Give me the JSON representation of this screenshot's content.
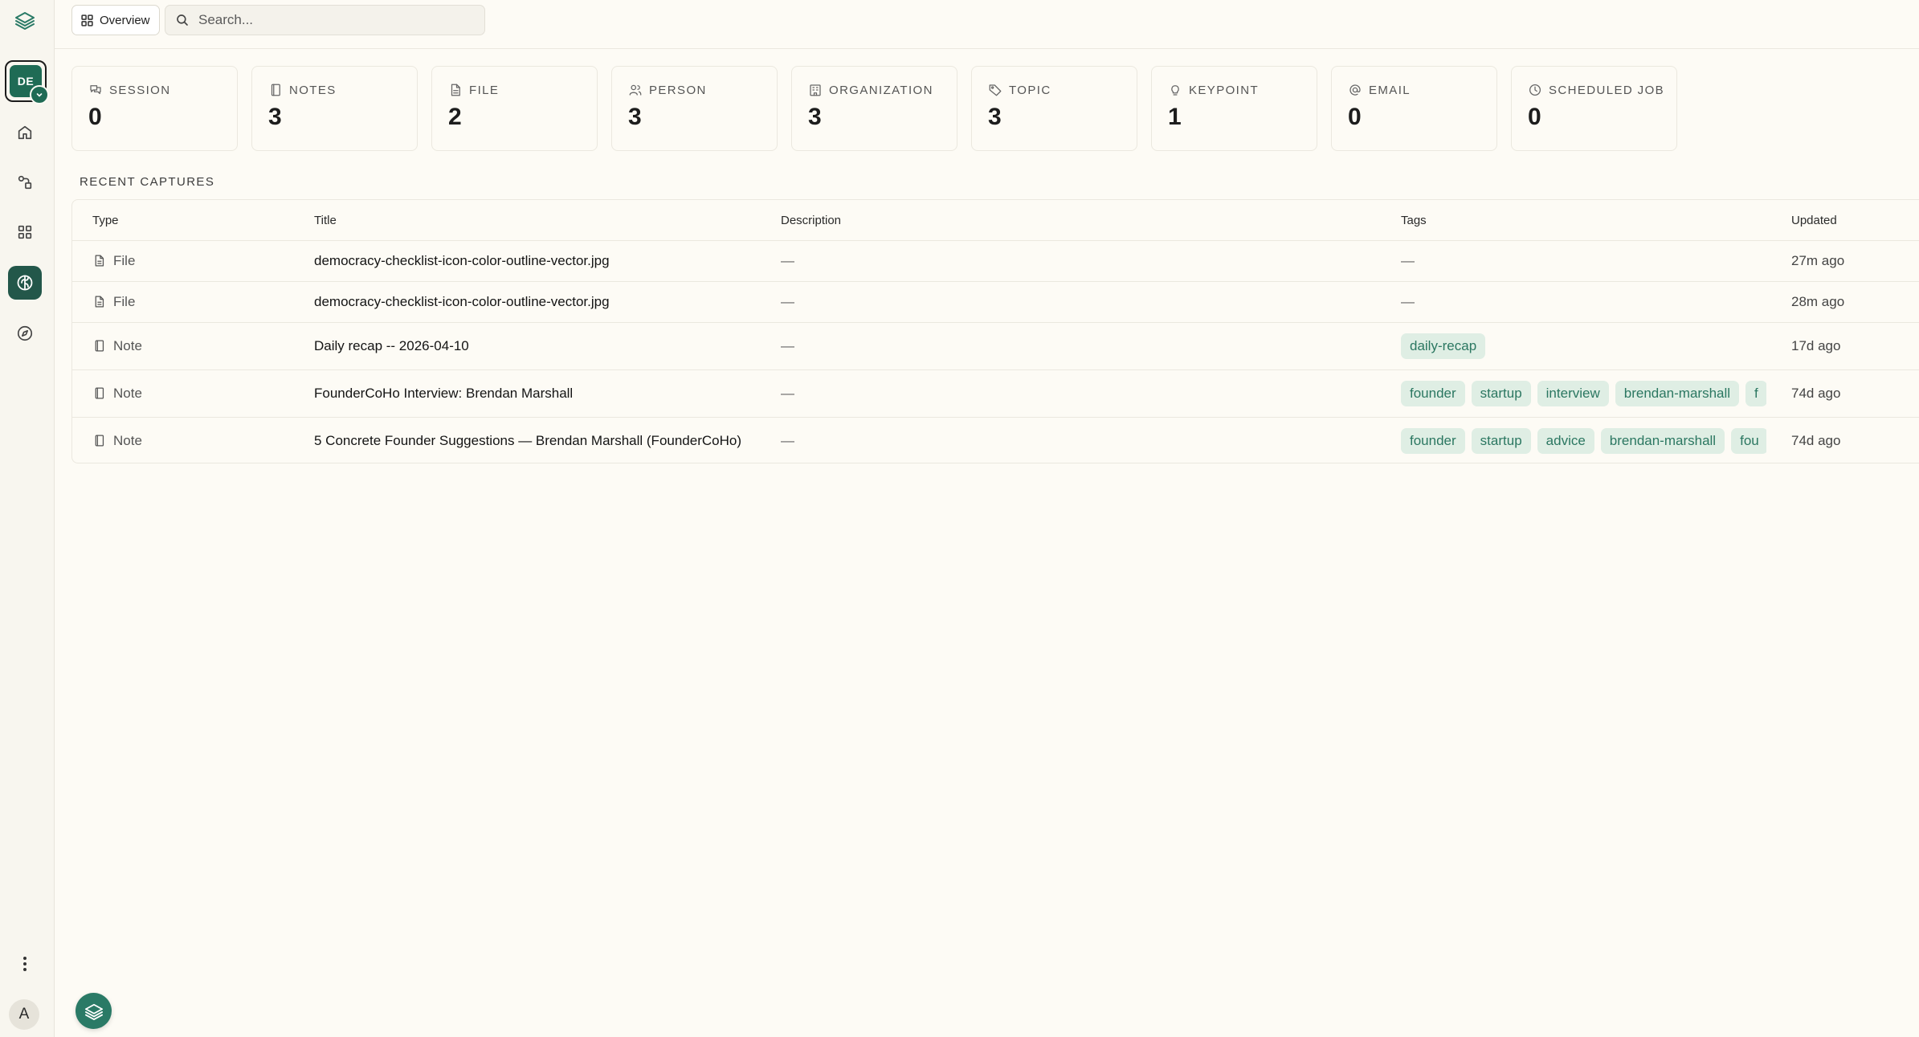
{
  "topbar": {
    "overview_label": "Overview",
    "search_placeholder": "Search..."
  },
  "sidebar": {
    "workspace_initials": "DE",
    "user_initial": "A",
    "nav_items": [
      {
        "name": "home",
        "icon": "home-icon"
      },
      {
        "name": "workflows",
        "icon": "workflow-icon"
      },
      {
        "name": "apps",
        "icon": "grid-icon"
      },
      {
        "name": "knowledge",
        "icon": "brain-icon",
        "active": true
      },
      {
        "name": "explore",
        "icon": "compass-icon"
      }
    ]
  },
  "stats": [
    {
      "label": "SESSION",
      "value": "0",
      "icon": "chat-icon"
    },
    {
      "label": "NOTES",
      "value": "3",
      "icon": "notebook-icon"
    },
    {
      "label": "FILE",
      "value": "2",
      "icon": "file-icon"
    },
    {
      "label": "PERSON",
      "value": "3",
      "icon": "people-icon"
    },
    {
      "label": "ORGANIZATION",
      "value": "3",
      "icon": "building-icon"
    },
    {
      "label": "TOPIC",
      "value": "3",
      "icon": "tag-icon"
    },
    {
      "label": "KEYPOINT",
      "value": "1",
      "icon": "lightbulb-icon"
    },
    {
      "label": "EMAIL",
      "value": "0",
      "icon": "at-icon"
    },
    {
      "label": "SCHEDULED JOB",
      "value": "0",
      "icon": "clock-icon"
    }
  ],
  "recent": {
    "title": "RECENT CAPTURES",
    "columns": {
      "type": "Type",
      "title": "Title",
      "description": "Description",
      "tags": "Tags",
      "updated": "Updated"
    },
    "rows": [
      {
        "type": "File",
        "title": "democracy-checklist-icon-color-outline-vector.jpg",
        "description": "—",
        "tags": [],
        "tags_empty": "—",
        "updated": "27m ago"
      },
      {
        "type": "File",
        "title": "democracy-checklist-icon-color-outline-vector.jpg",
        "description": "—",
        "tags": [],
        "tags_empty": "—",
        "updated": "28m ago"
      },
      {
        "type": "Note",
        "title": "Daily recap -- 2026-04-10",
        "description": "—",
        "tags": [
          "daily-recap"
        ],
        "updated": "17d ago"
      },
      {
        "type": "Note",
        "title": "FounderCoHo Interview: Brendan Marshall",
        "description": "—",
        "tags": [
          "founder",
          "startup",
          "interview",
          "brendan-marshall",
          "f"
        ],
        "updated": "74d ago"
      },
      {
        "type": "Note",
        "title": "5 Concrete Founder Suggestions — Brendan Marshall (FounderCoHo)",
        "description": "—",
        "tags": [
          "founder",
          "startup",
          "advice",
          "brendan-marshall",
          "fou"
        ],
        "updated": "74d ago"
      }
    ]
  },
  "colors": {
    "accent": "#1f6b55",
    "tag_bg": "#dfeee4",
    "tag_text": "#2b7761",
    "background": "#fdfbf5"
  }
}
